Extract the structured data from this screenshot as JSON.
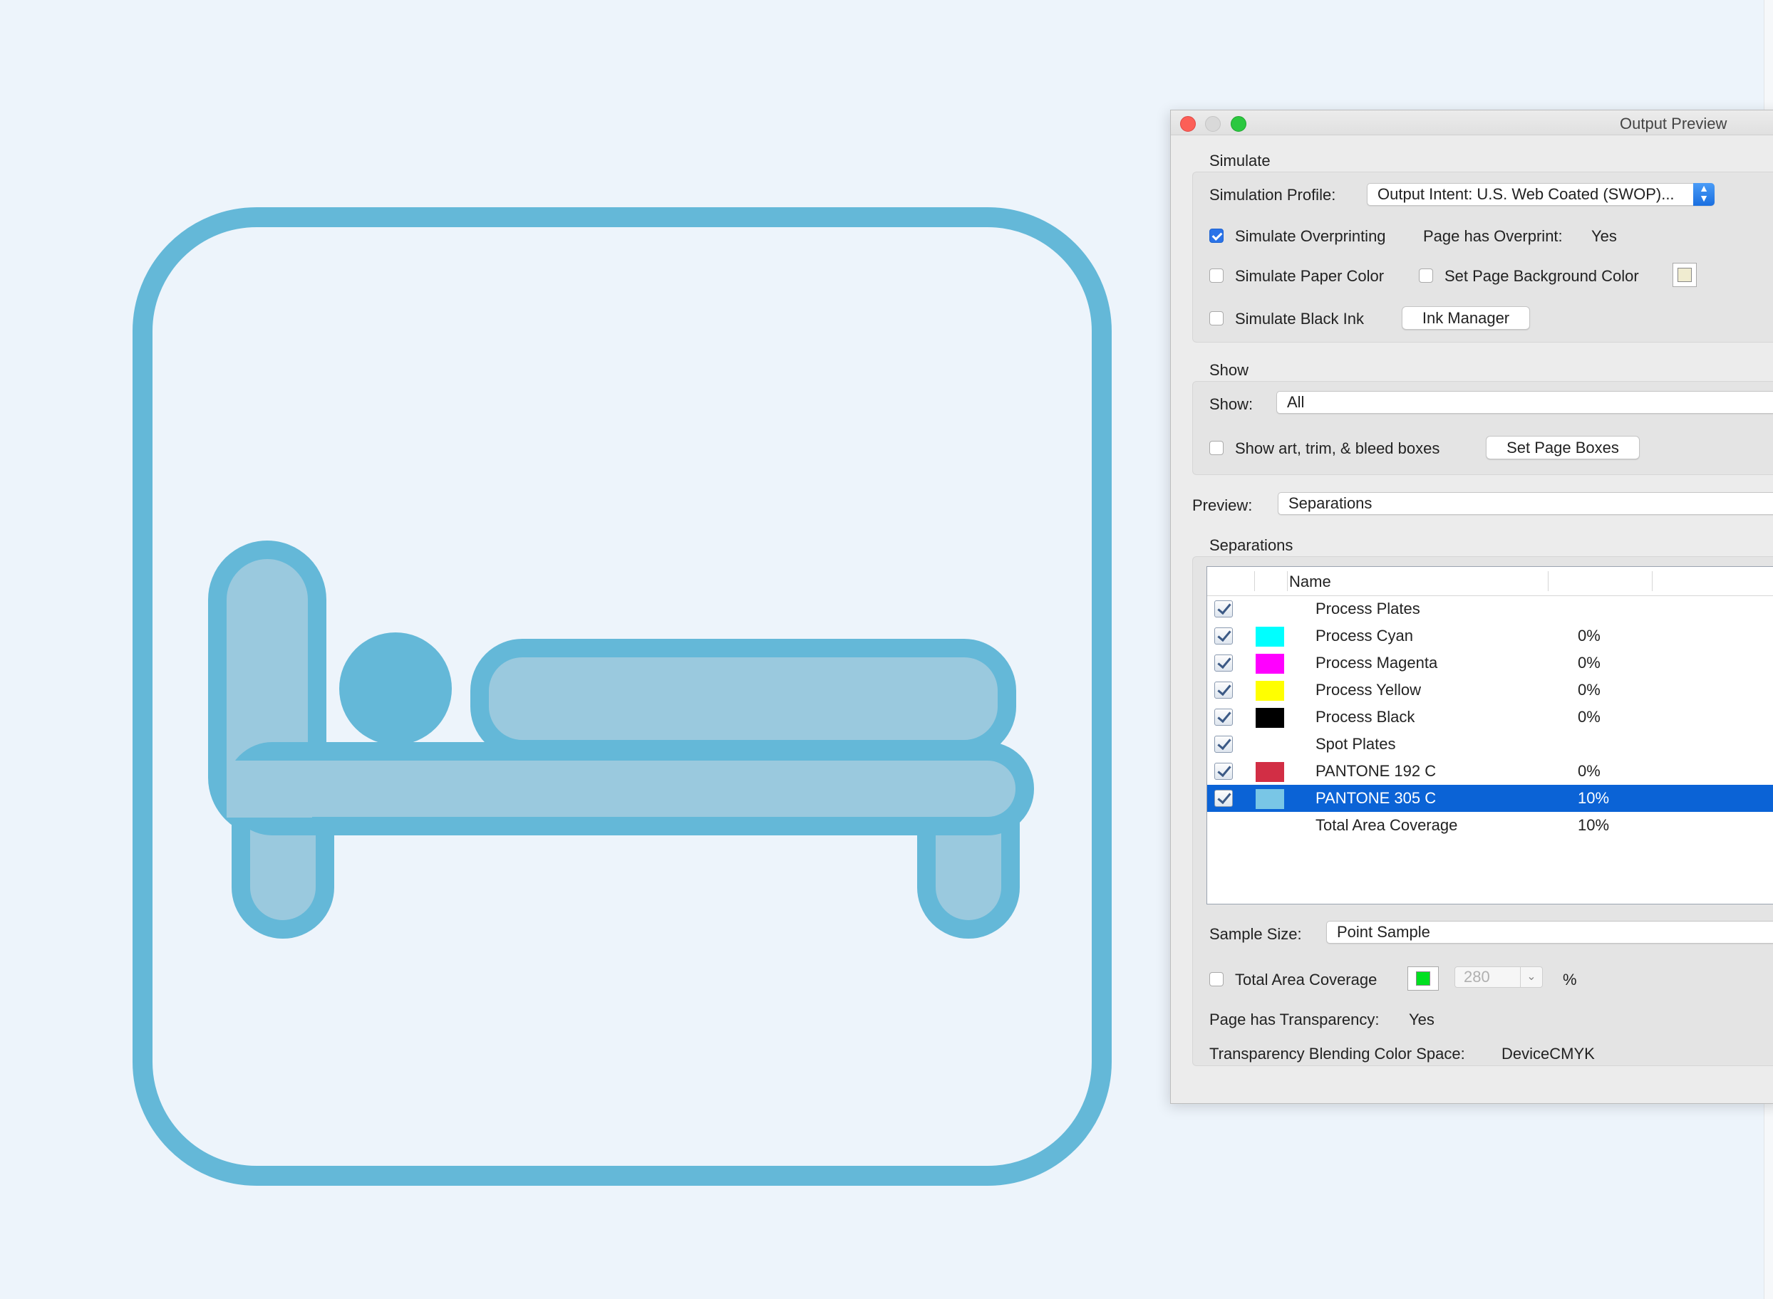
{
  "illustration": {
    "icon_name": "bed-icon",
    "colors": {
      "outline": "#64b8d8",
      "fill": "#9ac9de",
      "background": "#edf4fb"
    }
  },
  "window": {
    "title": "Output Preview"
  },
  "simulate": {
    "section_label": "Simulate",
    "profile_label": "Simulation Profile:",
    "profile_value": "Output Intent: U.S. Web Coated (SWOP)...",
    "simulate_overprinting": {
      "label": "Simulate Overprinting",
      "checked": true
    },
    "overprint_label": "Page has Overprint:",
    "overprint_value": "Yes",
    "simulate_paper_color": {
      "label": "Simulate Paper Color",
      "checked": false
    },
    "set_page_background": {
      "label": "Set Page Background Color",
      "checked": false
    },
    "simulate_black_ink": {
      "label": "Simulate Black Ink",
      "checked": false
    },
    "ink_manager_label": "Ink Manager"
  },
  "show": {
    "section_label": "Show",
    "show_label": "Show:",
    "show_value": "All",
    "boxes_checkbox": {
      "label": "Show art, trim, & bleed boxes",
      "checked": false
    },
    "set_page_boxes_label": "Set Page Boxes"
  },
  "preview": {
    "label": "Preview:",
    "value": "Separations"
  },
  "separations": {
    "section_label": "Separations",
    "column_name": "Name",
    "rows": [
      {
        "name": "Process Plates",
        "pct": "",
        "color": "",
        "checked": true,
        "selected": false
      },
      {
        "name": "Process Cyan",
        "pct": "0%",
        "color": "#00ffff",
        "checked": true,
        "selected": false
      },
      {
        "name": "Process Magenta",
        "pct": "0%",
        "color": "#ff00ff",
        "checked": true,
        "selected": false
      },
      {
        "name": "Process Yellow",
        "pct": "0%",
        "color": "#ffff00",
        "checked": true,
        "selected": false
      },
      {
        "name": "Process Black",
        "pct": "0%",
        "color": "#000000",
        "checked": true,
        "selected": false
      },
      {
        "name": "Spot Plates",
        "pct": "",
        "color": "",
        "checked": true,
        "selected": false
      },
      {
        "name": "PANTONE 192 C",
        "pct": "0%",
        "color": "#d22e45",
        "checked": true,
        "selected": false
      },
      {
        "name": "PANTONE 305 C",
        "pct": "10%",
        "color": "#79c6e6",
        "checked": true,
        "selected": true
      },
      {
        "name": "Total Area Coverage",
        "pct": "10%",
        "color": "",
        "checked": false,
        "selected": false
      }
    ]
  },
  "sample": {
    "label": "Sample Size:",
    "value": "Point Sample"
  },
  "coverage": {
    "checkbox": {
      "label": "Total Area Coverage",
      "checked": false
    },
    "swatch_color": "#00e020",
    "value": "280",
    "unit": "%"
  },
  "transparency": {
    "label": "Page has Transparency:",
    "value": "Yes",
    "blend_label": "Transparency Blending Color Space:",
    "blend_value": "DeviceCMYK"
  }
}
